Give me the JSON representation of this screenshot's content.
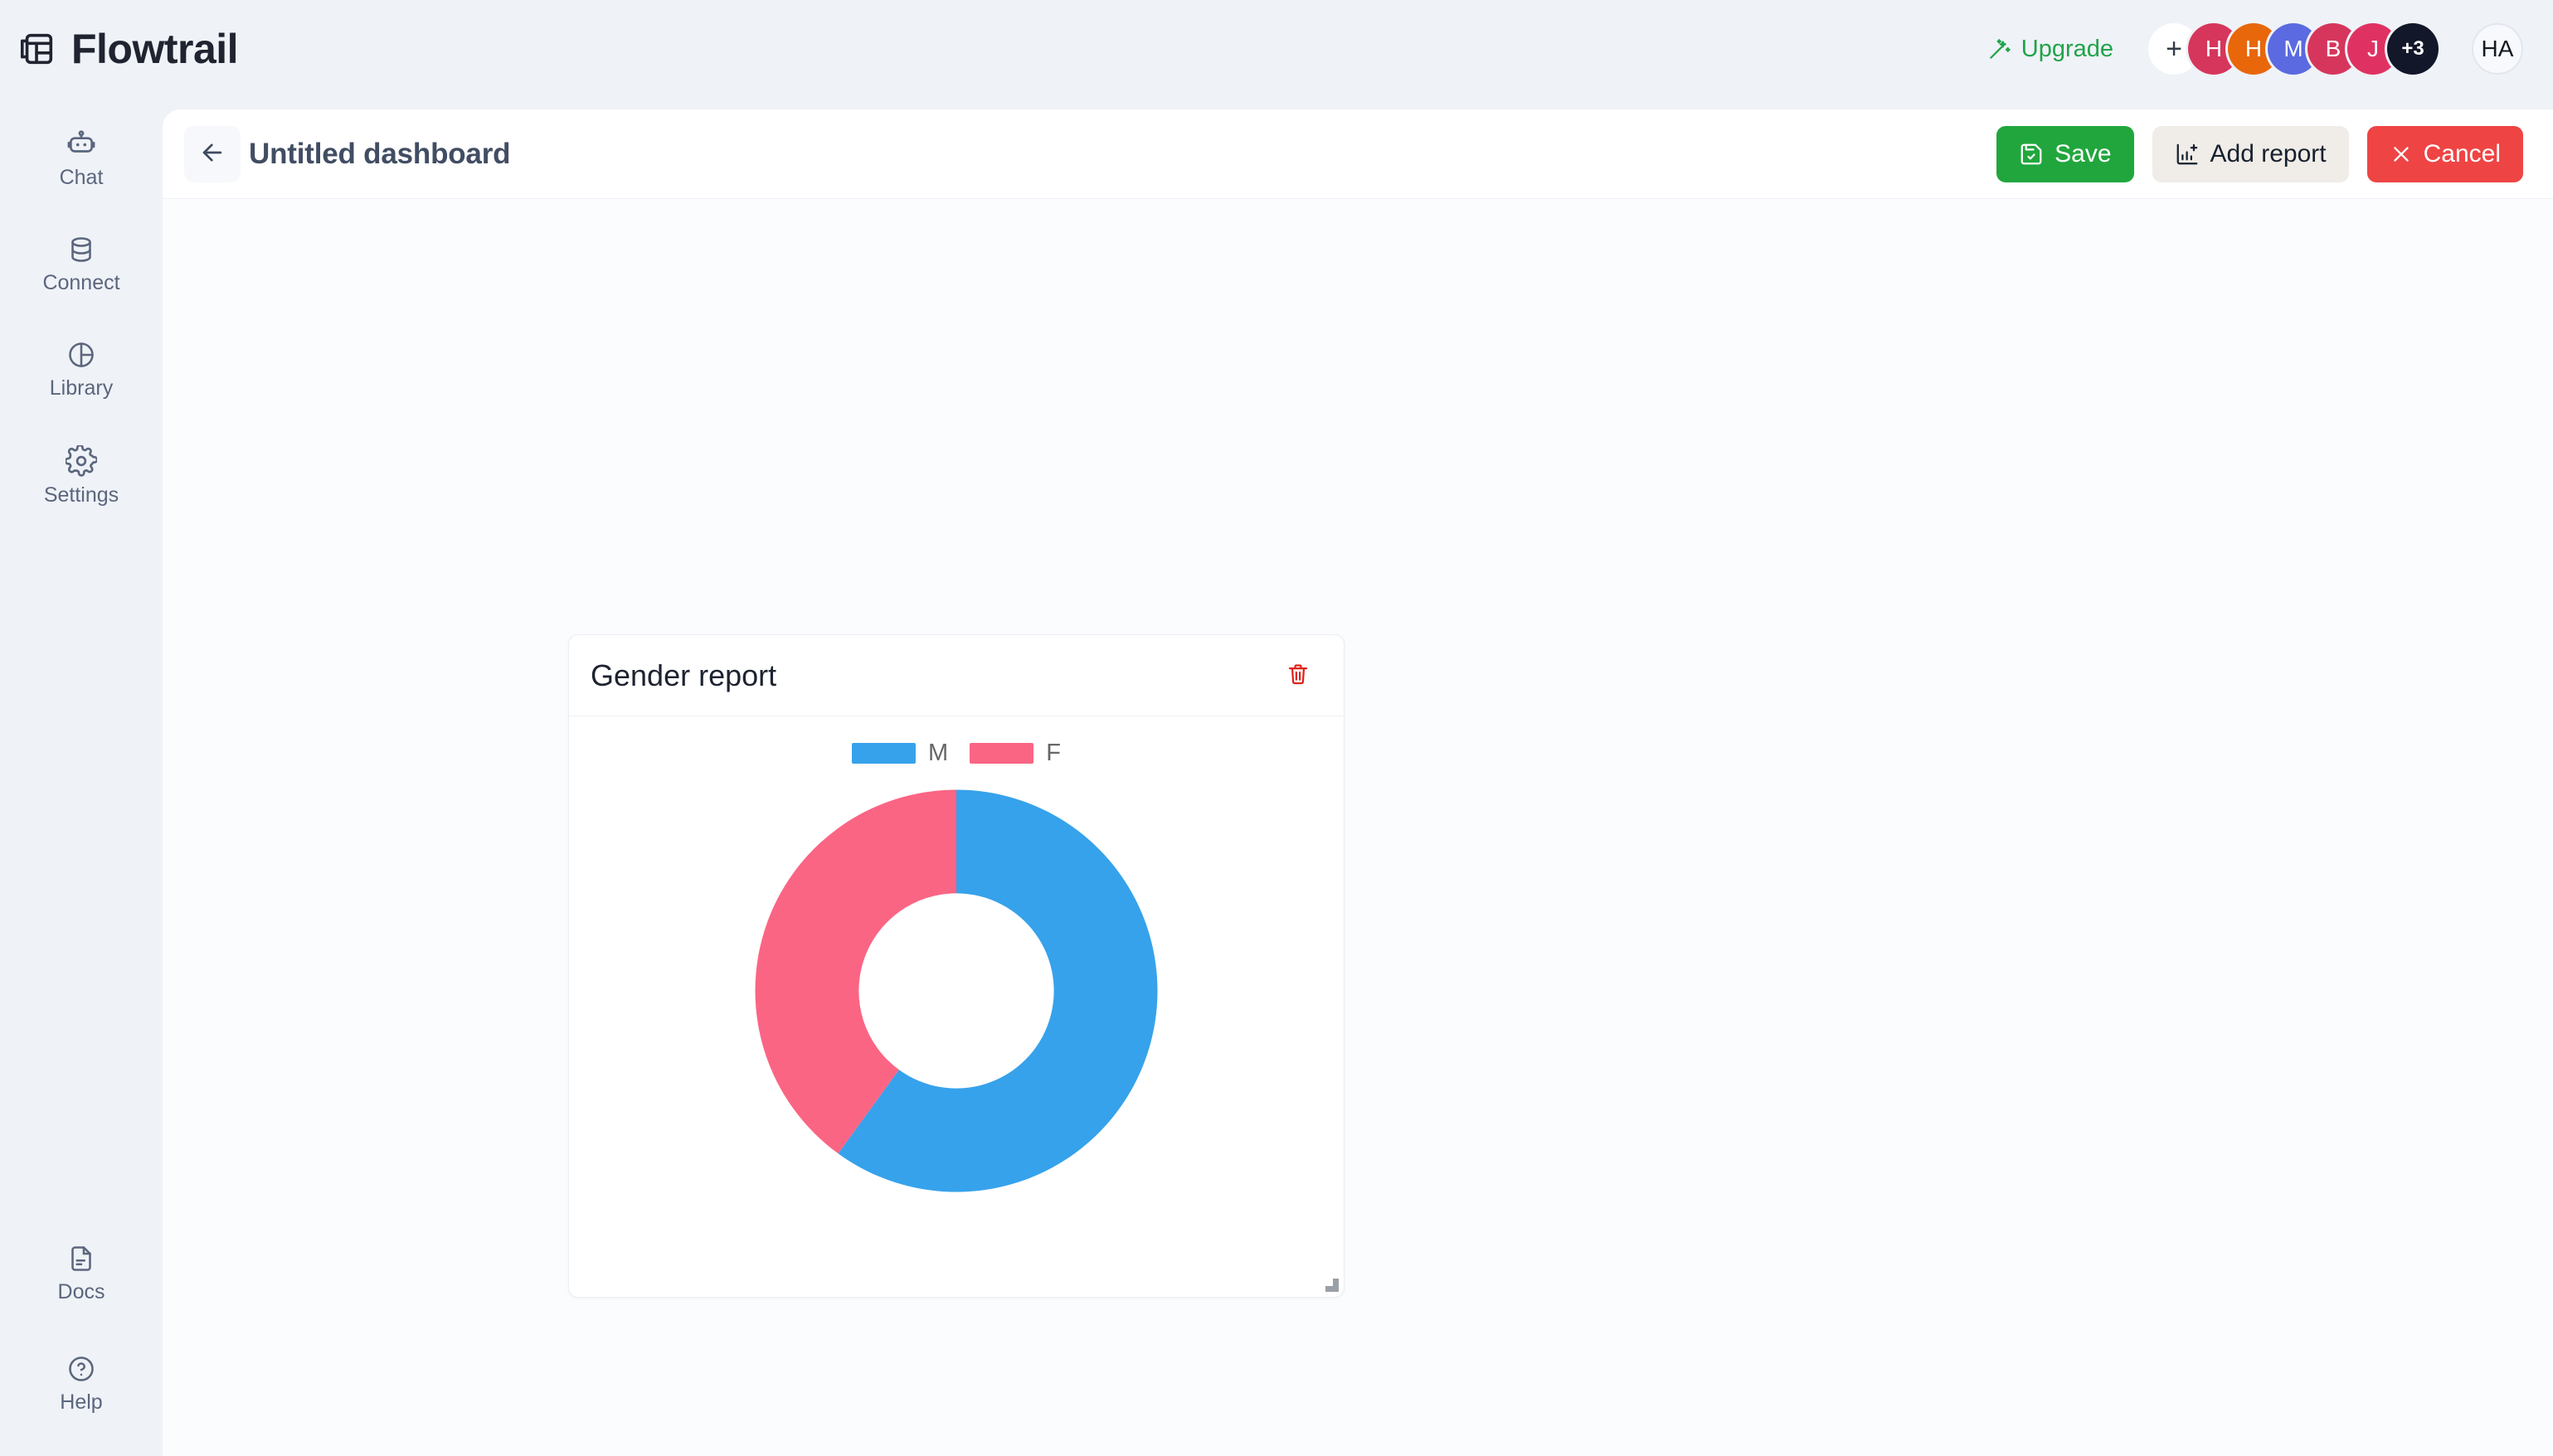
{
  "brand": {
    "name": "Flowtrail",
    "logo_icon": "grid-table-icon"
  },
  "topbar": {
    "upgrade_label": "Upgrade",
    "upgrade_icon": "magic-wand-icon",
    "upgrade_color": "#21a349",
    "add_member_icon": "plus-icon",
    "avatars": [
      {
        "initials": "+",
        "color": "#ffffff",
        "name": "add-member-avatar"
      },
      {
        "initials": "H",
        "color": "#d6365c",
        "name": "avatar-h-1"
      },
      {
        "initials": "H",
        "color": "#e8670b",
        "name": "avatar-h-2"
      },
      {
        "initials": "M",
        "color": "#5b6ae0",
        "name": "avatar-m"
      },
      {
        "initials": "B",
        "color": "#d6365c",
        "name": "avatar-b"
      },
      {
        "initials": "J",
        "color": "#e03262",
        "name": "avatar-j"
      },
      {
        "initials": "+3",
        "color": "#121729",
        "name": "avatar-overflow"
      }
    ],
    "current_user_initials": "HA"
  },
  "sidebar": {
    "top_items": [
      {
        "label": "Chat",
        "icon": "robot-icon"
      },
      {
        "label": "Connect",
        "icon": "database-icon"
      },
      {
        "label": "Library",
        "icon": "pie-circle-icon"
      },
      {
        "label": "Settings",
        "icon": "gear-icon"
      }
    ],
    "bottom_items": [
      {
        "label": "Docs",
        "icon": "document-icon"
      },
      {
        "label": "Help",
        "icon": "question-circle-icon"
      }
    ]
  },
  "panel_header": {
    "back_icon": "arrow-left-icon",
    "title": "Untitled dashboard",
    "buttons": [
      {
        "label": "Save",
        "icon": "save-disk-check-icon",
        "color": "#21a63d"
      },
      {
        "label": "Add report",
        "icon": "chart-plus-icon",
        "color": "#f0ece7"
      },
      {
        "label": "Cancel",
        "icon": "close-x-icon",
        "color": "#ef4444"
      }
    ]
  },
  "report_card": {
    "title": "Gender report",
    "delete_icon": "trash-icon",
    "delete_color": "#e0231a",
    "resize_handle_icon": "resize-corner-icon"
  },
  "chart_data": {
    "type": "pie",
    "variant": "donut",
    "title": "Gender report",
    "categories": [
      "M",
      "F"
    ],
    "values": [
      60,
      40
    ],
    "colors": [
      "#36a2eb",
      "#fb6584"
    ],
    "legend": [
      {
        "label": "M",
        "color": "#36a2eb"
      },
      {
        "label": "F",
        "color": "#fb6584"
      }
    ],
    "legend_position": "top",
    "start_angle_deg": 0,
    "direction": "clockwise",
    "inner_radius_ratio": 0.485,
    "grid": false,
    "xlabel": "",
    "ylabel": ""
  }
}
